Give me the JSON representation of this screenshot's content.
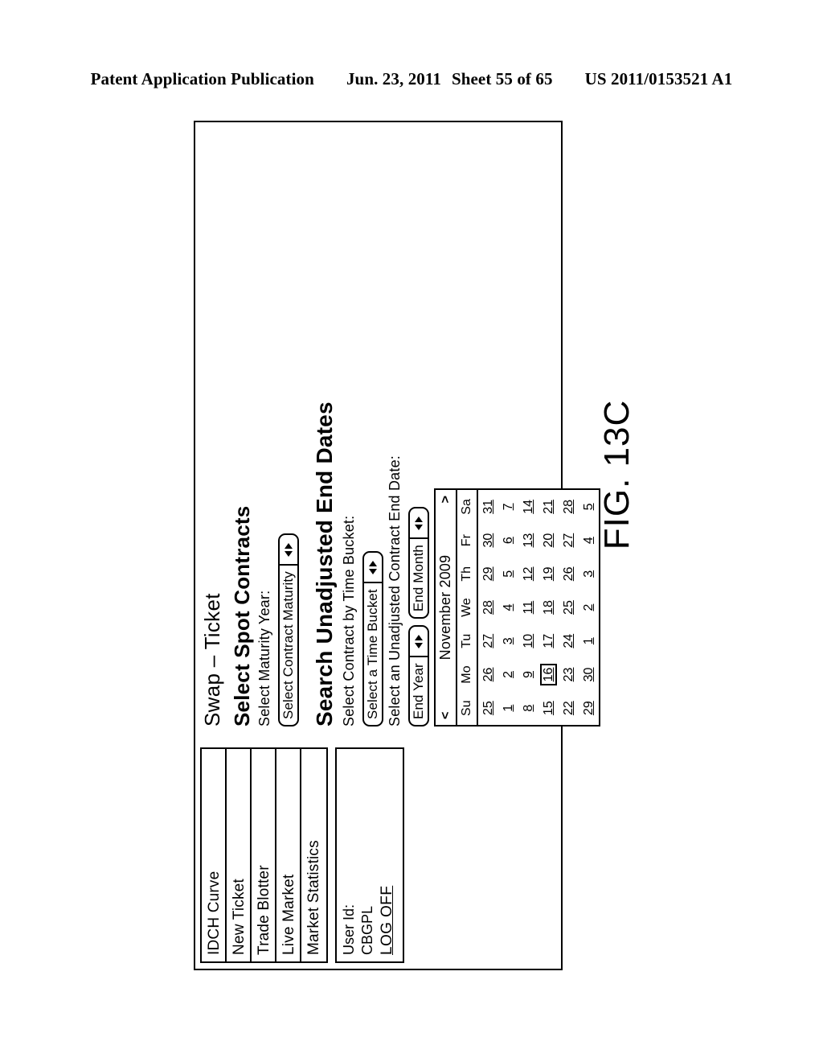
{
  "patent_header": {
    "publication": "Patent Application Publication",
    "date": "Jun. 23, 2011",
    "sheet": "Sheet 55 of 65",
    "number": "US 2011/0153521 A1"
  },
  "figure": {
    "label": "FIG. 13C"
  },
  "sidebar": {
    "items": [
      {
        "label": "IDCH Curve"
      },
      {
        "label": "New Ticket"
      },
      {
        "label": "Trade Blotter"
      },
      {
        "label": "Live Market"
      },
      {
        "label": "Market Statistics"
      }
    ],
    "user": {
      "id_label": "User Id:",
      "id_value": "CBGPL",
      "logoff_label": "LOG OFF"
    }
  },
  "main": {
    "title": "Swap – Ticket",
    "section_spot": {
      "heading": "Select Spot Contracts",
      "maturity_year_label": "Select Maturity Year:",
      "contract_maturity_select": "Select Contract Maturity"
    },
    "section_unadjusted": {
      "heading": "Search Unadjusted End Dates",
      "time_bucket_label": "Select Contract by Time Bucket:",
      "time_bucket_select": "Select a Time Bucket",
      "end_date_label": "Select an Unadjusted Contract End Date:",
      "end_year_select": "End Year",
      "end_month_select": "End Month"
    }
  },
  "calendar": {
    "title": "November 2009",
    "prev_label": "<",
    "next_label": ">",
    "weekdays": [
      "Su",
      "Mo",
      "Tu",
      "We",
      "Th",
      "Fr",
      "Sa"
    ],
    "selected_day": 16,
    "weeks": [
      [
        {
          "d": 25,
          "other": true
        },
        {
          "d": 26,
          "other": true
        },
        {
          "d": 27,
          "other": true
        },
        {
          "d": 28,
          "other": true
        },
        {
          "d": 29,
          "other": true
        },
        {
          "d": 30,
          "other": true
        },
        {
          "d": 31,
          "other": true
        }
      ],
      [
        {
          "d": 1
        },
        {
          "d": 2
        },
        {
          "d": 3
        },
        {
          "d": 4
        },
        {
          "d": 5
        },
        {
          "d": 6
        },
        {
          "d": 7
        }
      ],
      [
        {
          "d": 8
        },
        {
          "d": 9
        },
        {
          "d": 10
        },
        {
          "d": 11
        },
        {
          "d": 12
        },
        {
          "d": 13
        },
        {
          "d": 14
        }
      ],
      [
        {
          "d": 15
        },
        {
          "d": 16,
          "selected": true
        },
        {
          "d": 17
        },
        {
          "d": 18
        },
        {
          "d": 19
        },
        {
          "d": 20
        },
        {
          "d": 21
        }
      ],
      [
        {
          "d": 22
        },
        {
          "d": 23
        },
        {
          "d": 24
        },
        {
          "d": 25
        },
        {
          "d": 26
        },
        {
          "d": 27
        },
        {
          "d": 28
        }
      ],
      [
        {
          "d": 29
        },
        {
          "d": 30
        },
        {
          "d": 1,
          "other": true
        },
        {
          "d": 2,
          "other": true
        },
        {
          "d": 3,
          "other": true
        },
        {
          "d": 4,
          "other": true
        },
        {
          "d": 5,
          "other": true
        }
      ]
    ]
  }
}
